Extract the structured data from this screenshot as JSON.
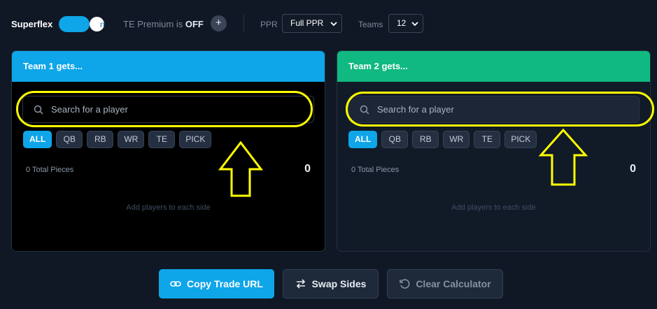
{
  "settings": {
    "superflex_label": "Superflex",
    "superflex_on": true,
    "toggle_tail": "n",
    "te_premium_prefix": "TE Premium is",
    "te_premium_state": "OFF",
    "te_add_symbol": "+",
    "ppr_label": "PPR",
    "ppr_value": "Full PPR",
    "teams_label": "Teams",
    "teams_value": "12"
  },
  "team1": {
    "title": "Team 1 gets...",
    "search_placeholder": "Search for a player",
    "filters": [
      "ALL",
      "QB",
      "RB",
      "WR",
      "TE",
      "PICK"
    ],
    "active_filter": "ALL",
    "pieces_label": "0 Total Pieces",
    "pieces_count": "0",
    "empty_message": "Add players to each side"
  },
  "team2": {
    "title": "Team 2 gets...",
    "search_placeholder": "Search for a player",
    "filters": [
      "ALL",
      "QB",
      "RB",
      "WR",
      "TE",
      "PICK"
    ],
    "active_filter": "ALL",
    "pieces_label": "0 Total Pieces",
    "pieces_count": "0",
    "empty_message": "Add players to each side"
  },
  "actions": {
    "copy_label": "Copy Trade URL",
    "swap_label": "Swap Sides",
    "clear_label": "Clear Calculator"
  },
  "icons": {
    "search": "search-icon",
    "link": "link-icon",
    "swap": "swap-arrows-icon",
    "reset": "reset-icon"
  },
  "colors": {
    "team1_accent": "#0ea5e9",
    "team2_accent": "#10b981",
    "annotation": "#ffff00"
  }
}
